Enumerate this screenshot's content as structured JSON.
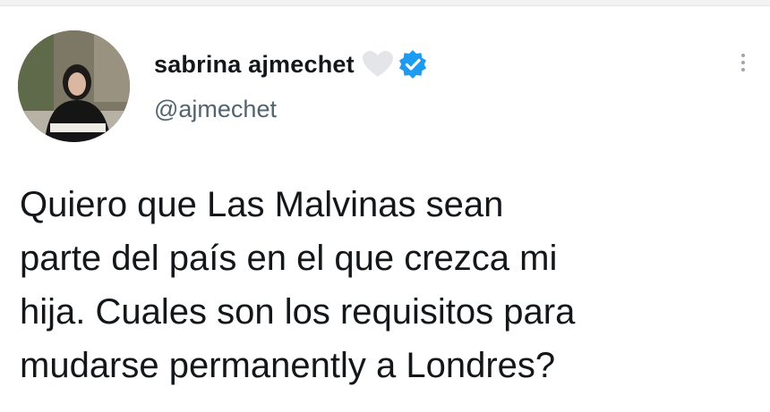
{
  "author": {
    "display_name": "sabrina ajmechet",
    "handle": "@ajmechet",
    "verified": true
  },
  "icons": {
    "heart": "heart-icon",
    "verified": "verified-badge-icon",
    "more": "more-options-icon"
  },
  "tweet": {
    "lines": [
      "Quiero que Las Malvinas sean",
      "parte del país en el que crezca mi",
      "hija. Cuales son los requisitos para",
      "mudarse permanently a Londres?"
    ]
  },
  "colors": {
    "verified_blue": "#1d9bf0",
    "heart_gray": "#e1e4e8",
    "text": "#14171a",
    "handle": "#536471"
  }
}
